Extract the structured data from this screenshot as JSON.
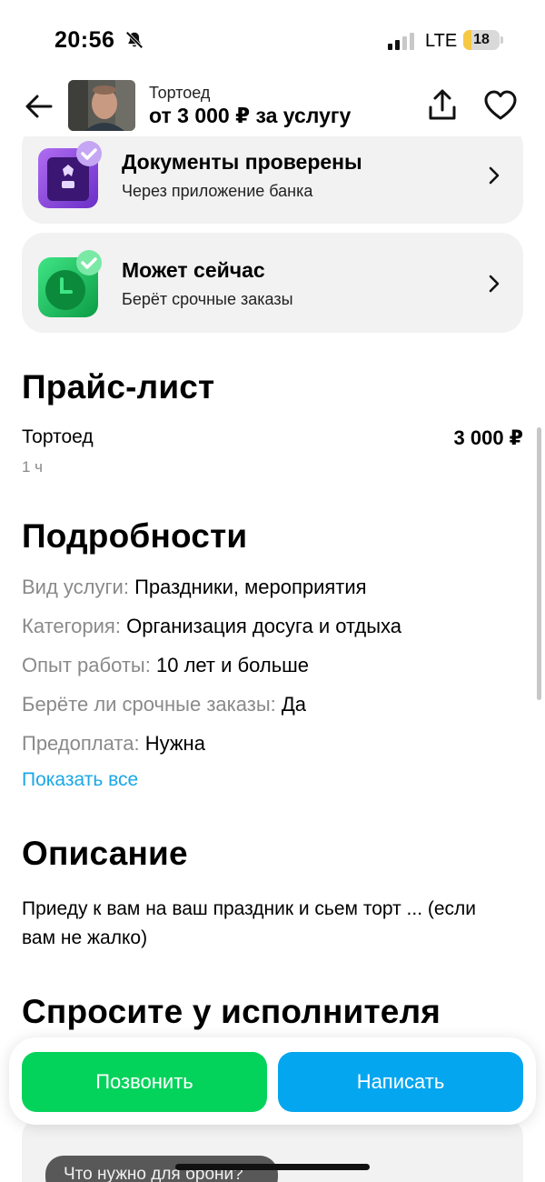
{
  "status_bar": {
    "time": "20:56",
    "network": "LTE",
    "battery": "18",
    "battery_level": 0.18,
    "icons": [
      "bell-slash-icon",
      "signal-icon",
      "battery-icon"
    ]
  },
  "header": {
    "name": "Тортоед",
    "price": "от 3 000 ₽ за услугу",
    "icons": [
      "arrow-left-icon",
      "share-icon",
      "heart-icon"
    ]
  },
  "cards": {
    "docs": {
      "title": "Документы проверены",
      "subtitle": "Через приложение банка",
      "icon": "verified-documents-icon"
    },
    "now": {
      "title": "Может сейчас",
      "subtitle": "Берёт срочные заказы",
      "icon": "clock-check-icon"
    }
  },
  "pricelist": {
    "title": "Прайс-лист",
    "items": [
      {
        "name": "Тортоед",
        "price": "3 000 ₽",
        "duration": "1 ч"
      }
    ]
  },
  "details": {
    "title": "Подробности",
    "rows": [
      {
        "key": "Вид услуги:",
        "value": "Праздники, мероприятия"
      },
      {
        "key": "Категория:",
        "value": "Организация досуга и отдыха"
      },
      {
        "key": "Опыт работы:",
        "value": "10 лет и больше"
      },
      {
        "key": "Берёте ли срочные заказы:",
        "value": "Да"
      },
      {
        "key": "Предоплата:",
        "value": "Нужна"
      }
    ],
    "show_all": "Показать все"
  },
  "description": {
    "title": "Описание",
    "text": "Приеду к вам на ваш праздник и сьем торт ... (если вам не жалко)"
  },
  "ask": {
    "title": "Спросите у исполнителя",
    "chip": "Что нужно для брони?"
  },
  "actions": {
    "call": "Позвонить",
    "write": "Написать"
  },
  "colors": {
    "green": "#04d35b",
    "blue": "#05a6f0",
    "link": "#1aa7e8",
    "card_bg": "#f2f2f2",
    "muted": "#8a8a8a"
  }
}
